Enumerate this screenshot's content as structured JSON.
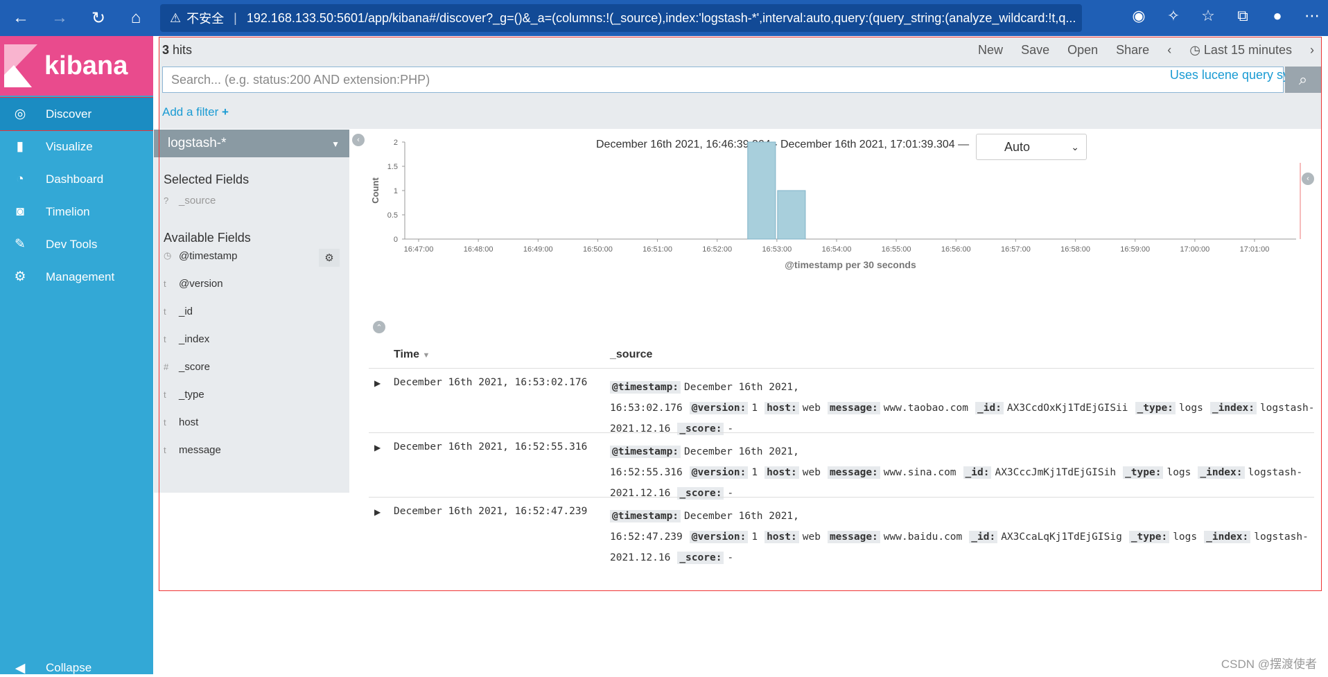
{
  "browser": {
    "warning": "不安全",
    "url": "192.168.133.50:5601/app/kibana#/discover?_g=()&_a=(columns:!(_source),index:'logstash-*',interval:auto,query:(query_string:(analyze_wildcard:!t,q..."
  },
  "sidebar": {
    "brand": "kibana",
    "items": [
      {
        "label": "Discover"
      },
      {
        "label": "Visualize"
      },
      {
        "label": "Dashboard"
      },
      {
        "label": "Timelion"
      },
      {
        "label": "Dev Tools"
      },
      {
        "label": "Management"
      }
    ],
    "collapse": "Collapse"
  },
  "topbar": {
    "hits_count": "3",
    "hits_label": "hits",
    "new": "New",
    "save": "Save",
    "open": "Open",
    "share": "Share",
    "time_range": "Last 15 minutes"
  },
  "search": {
    "placeholder": "Search... (e.g. status:200 AND extension:PHP)",
    "syntax_hint": "Uses lucene query syntax"
  },
  "filters": {
    "add_filter": "Add a filter"
  },
  "fields_panel": {
    "index_pattern": "logstash-*",
    "selected_title": "Selected Fields",
    "selected": [
      {
        "type": "?",
        "name": "_source"
      }
    ],
    "available_title": "Available Fields",
    "available": [
      {
        "type": "◷",
        "name": "@timestamp"
      },
      {
        "type": "t",
        "name": "@version"
      },
      {
        "type": "t",
        "name": "_id"
      },
      {
        "type": "t",
        "name": "_index"
      },
      {
        "type": "#",
        "name": "_score"
      },
      {
        "type": "t",
        "name": "_type"
      },
      {
        "type": "t",
        "name": "host"
      },
      {
        "type": "t",
        "name": "message"
      }
    ]
  },
  "histogram": {
    "date_range": "December 16th 2021, 16:46:39.304 - December 16th 2021, 17:01:39.304 —",
    "interval": "Auto"
  },
  "chart_data": {
    "type": "bar",
    "ylabel": "Count",
    "xlabel": "@timestamp per 30 seconds",
    "ylim": [
      0,
      2
    ],
    "yticks": [
      "0",
      "0.5",
      "1",
      "1.5",
      "2"
    ],
    "xticks": [
      "16:47:00",
      "16:48:00",
      "16:49:00",
      "16:50:00",
      "16:51:00",
      "16:52:00",
      "16:53:00",
      "16:54:00",
      "16:55:00",
      "16:56:00",
      "16:57:00",
      "16:58:00",
      "16:59:00",
      "17:00:00",
      "17:01:00"
    ],
    "bars": [
      {
        "x": "16:52:30",
        "value": 2
      },
      {
        "x": "16:53:00",
        "value": 1
      }
    ],
    "bar_color": "#a8cfdc"
  },
  "table": {
    "col_time": "Time",
    "col_source": "_source",
    "rows": [
      {
        "time": "December 16th 2021, 16:53:02.176",
        "fields": [
          {
            "k": "@timestamp:",
            "v": "December 16th 2021, 16:53:02.176"
          },
          {
            "k": "@version:",
            "v": "1"
          },
          {
            "k": "host:",
            "v": "web"
          },
          {
            "k": "message:",
            "v": "www.taobao.com"
          },
          {
            "k": "_id:",
            "v": "AX3CcdOxKj1TdEjGISii"
          },
          {
            "k": "_type:",
            "v": "logs"
          },
          {
            "k": "_index:",
            "v": "logstash-2021.12.16"
          },
          {
            "k": "_score:",
            "v": "-"
          }
        ]
      },
      {
        "time": "December 16th 2021, 16:52:55.316",
        "fields": [
          {
            "k": "@timestamp:",
            "v": "December 16th 2021, 16:52:55.316"
          },
          {
            "k": "@version:",
            "v": "1"
          },
          {
            "k": "host:",
            "v": "web"
          },
          {
            "k": "message:",
            "v": "www.sina.com"
          },
          {
            "k": "_id:",
            "v": "AX3CccJmKj1TdEjGISih"
          },
          {
            "k": "_type:",
            "v": "logs"
          },
          {
            "k": "_index:",
            "v": "logstash-2021.12.16"
          },
          {
            "k": "_score:",
            "v": "-"
          }
        ]
      },
      {
        "time": "December 16th 2021, 16:52:47.239",
        "fields": [
          {
            "k": "@timestamp:",
            "v": "December 16th 2021, 16:52:47.239"
          },
          {
            "k": "@version:",
            "v": "1"
          },
          {
            "k": "host:",
            "v": "web"
          },
          {
            "k": "message:",
            "v": "www.baidu.com"
          },
          {
            "k": "_id:",
            "v": "AX3CcaLqKj1TdEjGISig"
          },
          {
            "k": "_type:",
            "v": "logs"
          },
          {
            "k": "_index:",
            "v": "logstash-2021.12.16"
          },
          {
            "k": "_score:",
            "v": "-"
          }
        ]
      }
    ]
  },
  "watermark": "CSDN @摆渡使者"
}
